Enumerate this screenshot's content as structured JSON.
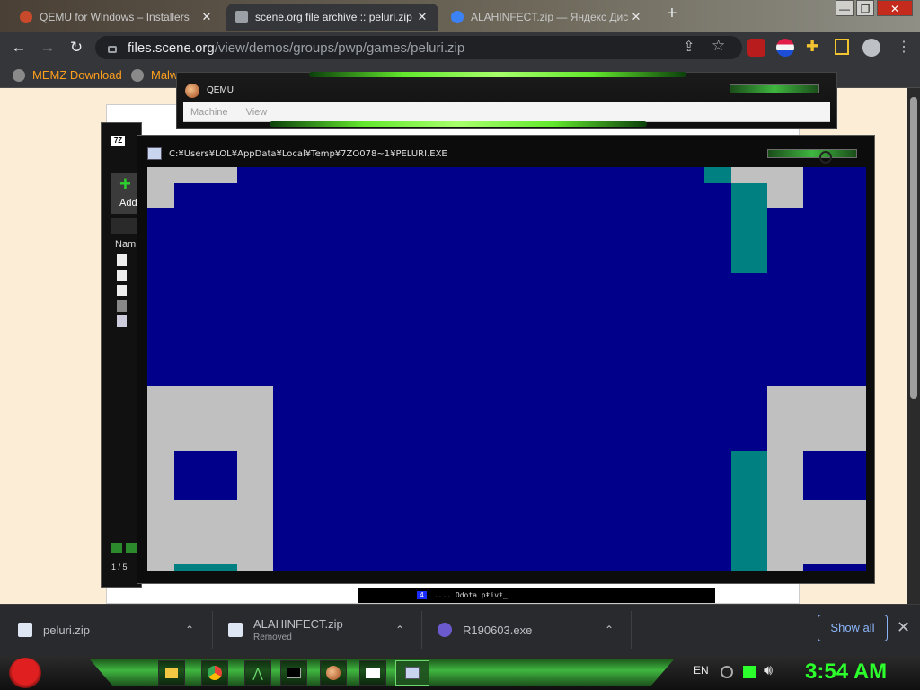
{
  "browser": {
    "tabs": [
      {
        "title": "QEMU for Windows – Installers",
        "fav_color": "#c94a2a",
        "active": false
      },
      {
        "title": "scene.org file archive :: peluri.zip",
        "fav_color": "#9aa0a6",
        "active": true
      },
      {
        "title": "ALAHINFECT.zip — Яндекс Диск",
        "fav_color": "#3b82f6",
        "active": false
      }
    ],
    "new_tab_glyph": "+",
    "close_glyph": "✕",
    "window_controls": [
      "—",
      "❐",
      "✕"
    ],
    "url_host": "files.scene.org",
    "url_path": "/view/demos/groups/pwp/games/peluri.zip",
    "bookmarks": [
      "MEMZ Download",
      "Malw"
    ]
  },
  "qemu_window": {
    "title": "QEMU",
    "menu": [
      "Machine",
      "View"
    ]
  },
  "sevenzip_window": {
    "app_badge": "7Z",
    "add_label": "Add",
    "name_header": "Nam",
    "status": "1 / 5"
  },
  "game_window": {
    "title": "C:¥Users¥LOL¥AppData¥Local¥Temp¥7ZO078~1¥PELURI.EXE",
    "status_num": "4",
    "status_text": ".... Odota pŧivŧ_"
  },
  "downloads": {
    "items": [
      {
        "name": "peluri.zip",
        "sub": ""
      },
      {
        "name": "ALAHINFECT.zip",
        "sub": "Removed"
      },
      {
        "name": "R190603.exe",
        "sub": ""
      }
    ],
    "show_all": "Show all",
    "chevron": "⌃",
    "close": "✕"
  },
  "taskbar": {
    "language": "EN",
    "clock": "3:54 AM",
    "apps": [
      "file-explorer",
      "chrome",
      "task",
      "cmd",
      "qemu",
      "7zip",
      "peluri"
    ]
  },
  "colors": {
    "game_bg": "#00008a",
    "game_gray": "#c0c0c0",
    "game_teal": "#008080",
    "clock": "#2cff2c",
    "bookmark": "#ff9f1c"
  }
}
